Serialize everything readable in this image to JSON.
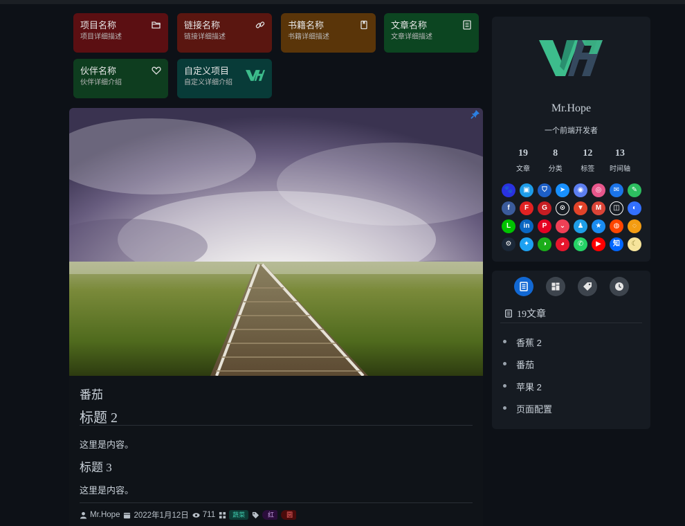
{
  "projects": [
    {
      "title": "项目名称",
      "desc": "项目详细描述",
      "icon": "folder-icon",
      "color": "#5b0f12"
    },
    {
      "title": "链接名称",
      "desc": "链接详细描述",
      "icon": "link-icon",
      "color": "#5a1610"
    },
    {
      "title": "书籍名称",
      "desc": "书籍详细描述",
      "icon": "book-icon",
      "color": "#5a3509"
    },
    {
      "title": "文章名称",
      "desc": "文章详细描述",
      "icon": "article-icon",
      "color": "#0c4521"
    },
    {
      "title": "伙伴名称",
      "desc": "伙伴详细介绍",
      "icon": "heart-icon",
      "color": "#0e3d1f"
    },
    {
      "title": "自定义项目",
      "desc": "自定义详细介绍",
      "icon": "vh-logo-icon",
      "color": "#083b38"
    }
  ],
  "article": {
    "subtitle": "番茄",
    "heading2": "标题 2",
    "para1": "这里是内容。",
    "heading3": "标题 3",
    "para2": "这里是内容。",
    "meta": {
      "author": "Mr.Hope",
      "date": "2022年1月12日",
      "views": "711",
      "category": "蔬菜",
      "tags": [
        "红",
        "圆"
      ]
    }
  },
  "profile": {
    "name": "Mr.Hope",
    "description": "一个前端开发者",
    "stats": [
      {
        "num": "19",
        "label": "文章"
      },
      {
        "num": "8",
        "label": "分类"
      },
      {
        "num": "12",
        "label": "标签"
      },
      {
        "num": "13",
        "label": "时间轴"
      }
    ],
    "socials": [
      {
        "name": "baidu-icon",
        "color": "#2932e1",
        "glyph": "🐾"
      },
      {
        "name": "bilibili-icon",
        "color": "#1e9ce8",
        "glyph": "▣"
      },
      {
        "name": "bitbucket-icon",
        "color": "#1d5fc7",
        "glyph": "⛉"
      },
      {
        "name": "dingding-icon",
        "color": "#1890ff",
        "glyph": "➤"
      },
      {
        "name": "discord-icon",
        "color": "#5d7ff0",
        "glyph": "◉"
      },
      {
        "name": "dribbble-icon",
        "color": "#e8578c",
        "glyph": "◎"
      },
      {
        "name": "email-icon",
        "color": "#1b74e8",
        "glyph": "✉"
      },
      {
        "name": "evernote-icon",
        "color": "#2dbe60",
        "glyph": "✎"
      },
      {
        "name": "facebook-icon",
        "color": "#3b5b9b",
        "glyph": "f"
      },
      {
        "name": "flipboard-icon",
        "color": "#e22222",
        "glyph": "F"
      },
      {
        "name": "gitee-icon",
        "color": "#c71d23",
        "glyph": "G"
      },
      {
        "name": "github-icon",
        "color": "#161b22",
        "glyph": "⊙"
      },
      {
        "name": "gitlab-icon",
        "color": "#e24329",
        "glyph": "▼"
      },
      {
        "name": "gmail-icon",
        "color": "#db4437",
        "glyph": "M"
      },
      {
        "name": "instagram-icon",
        "color": "#161b22",
        "glyph": "◫"
      },
      {
        "name": "lark-icon",
        "color": "#3370ff",
        "glyph": "◐"
      },
      {
        "name": "line-icon",
        "color": "#00c300",
        "glyph": "L"
      },
      {
        "name": "linkedin-icon",
        "color": "#0a66c2",
        "glyph": "in"
      },
      {
        "name": "pinterest-icon",
        "color": "#e60023",
        "glyph": "P"
      },
      {
        "name": "pocket-icon",
        "color": "#ef4056",
        "glyph": "⌄"
      },
      {
        "name": "qq-icon",
        "color": "#1e9ee8",
        "glyph": "♟"
      },
      {
        "name": "qzone-icon",
        "color": "#1a8cf1",
        "glyph": "★"
      },
      {
        "name": "reddit-icon",
        "color": "#ff4500",
        "glyph": "◍"
      },
      {
        "name": "rss-icon",
        "color": "#f39c12",
        "glyph": "◌"
      },
      {
        "name": "steam-icon",
        "color": "#1b2838",
        "glyph": "⚙"
      },
      {
        "name": "twitter-icon",
        "color": "#1da1f2",
        "glyph": "✦"
      },
      {
        "name": "wechat-icon",
        "color": "#1aad19",
        "glyph": "◑"
      },
      {
        "name": "weibo-icon",
        "color": "#e6162d",
        "glyph": "◕"
      },
      {
        "name": "whatsapp-icon",
        "color": "#25d366",
        "glyph": "✆"
      },
      {
        "name": "youtube-icon",
        "color": "#ff0000",
        "glyph": "▶"
      },
      {
        "name": "zhihu-icon",
        "color": "#0066ff",
        "glyph": "知"
      },
      {
        "name": "moon-icon",
        "color": "#f6e49b",
        "glyph": "☾"
      }
    ]
  },
  "blognav": {
    "tabs": [
      "article-icon",
      "category-icon",
      "tag-icon",
      "timeline-icon"
    ],
    "heading": "19文章",
    "items": [
      "香蕉 2",
      "番茄",
      "苹果 2",
      "页面配置"
    ]
  }
}
